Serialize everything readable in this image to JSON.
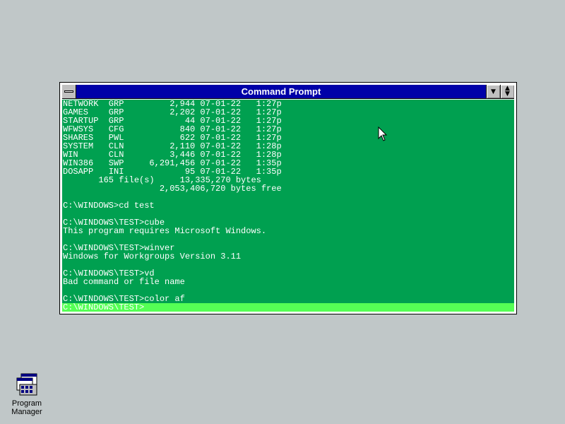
{
  "window": {
    "title": "Command Prompt",
    "sysmenu_icon": "system-menu-bar",
    "minimize_icon": "triangle-down",
    "restore_icon": "up-down-arrows"
  },
  "console": {
    "lines": [
      "NETWORK  GRP         2,944 07-01-22   1:27p",
      "GAMES    GRP         2,202 07-01-22   1:27p",
      "STARTUP  GRP            44 07-01-22   1:27p",
      "WFWSYS   CFG           840 07-01-22   1:27p",
      "SHARES   PWL           622 07-01-22   1:27p",
      "SYSTEM   CLN         2,110 07-01-22   1:28p",
      "WIN      CLN         3,446 07-01-22   1:28p",
      "WIN386   SWP     6,291,456 07-01-22   1:35p",
      "DOSAPP   INI            95 07-01-22   1:35p",
      "       165 file(s)     13,335,270 bytes",
      "                   2,053,406,720 bytes free",
      "",
      "C:\\WINDOWS>cd test",
      "",
      "C:\\WINDOWS\\TEST>cube",
      "This program requires Microsoft Windows.",
      "",
      "C:\\WINDOWS\\TEST>winver",
      "Windows for Workgroups Version 3.11",
      "",
      "C:\\WINDOWS\\TEST>vd",
      "Bad command or file name",
      "",
      "C:\\WINDOWS\\TEST>color af"
    ],
    "current_prompt": "C:\\WINDOWS\\TEST>",
    "background_color": "#00a050",
    "text_color": "#ffffff",
    "highlight_color": "#55ff55"
  },
  "desktop": {
    "background_color": "#c0c7c8",
    "icons": [
      {
        "label": "Program\nManager",
        "icon": "program-manager-icon"
      }
    ]
  }
}
